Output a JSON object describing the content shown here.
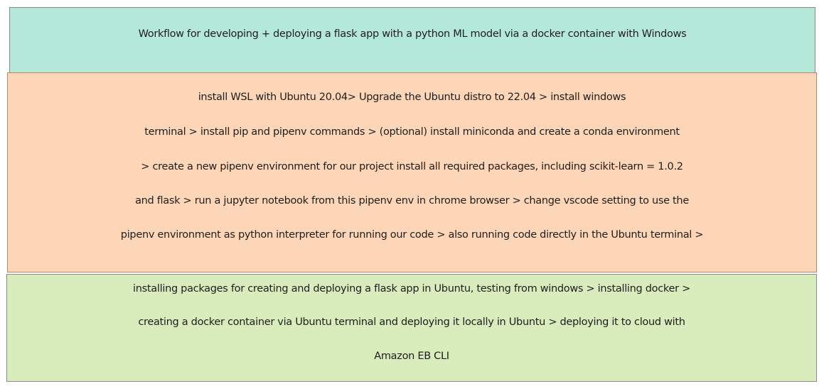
{
  "title": "Workflow  for developing + deploying a flask app with a python ML model via a docker container with Windows",
  "setup_steps": [
    "install WSL with Ubuntu 20.04> Upgrade the Ubuntu distro to 22.04 > install windows",
    "terminal > install pip and pipenv commands >  (optional) install miniconda and create a conda environment",
    "> create a new pipenv environment  for  our  project install all required packages, including scikit-learn = 1.0.2",
    "and flask > run a jupyter notebook from this pipenv  env in chrome browser > change vscode setting to use the",
    "pipenv environment as python interpreter for running our code >  also running code directly in the Ubuntu terminal >"
  ],
  "deploy_steps": [
    "installing packages for creating and deploying a flask app in Ubuntu, testing from windows > installing docker >",
    "creating a docker container via Ubuntu terminal and deploying it locally in Ubuntu > deploying it to cloud with",
    "Amazon EB CLI"
  ],
  "colors": {
    "title_box": "#b4e9da",
    "setup_box": "#fdd6b7",
    "deploy_box": "#d9edbc"
  }
}
